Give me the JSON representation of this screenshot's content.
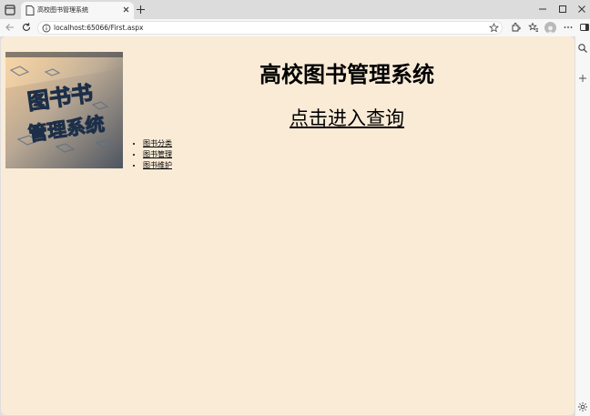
{
  "browser": {
    "tab_title": "高校图书管理系统",
    "url": "localhost:65066/First.aspx"
  },
  "page": {
    "title": "高校图书管理系统",
    "query_link": "点击进入查询",
    "nav_items": [
      "图书分类",
      "图书管理",
      "图书维护"
    ],
    "logo_text": [
      "图书书",
      "管理系统"
    ]
  },
  "colors": {
    "page_background": "#faebd7",
    "chrome_background": "#f7f7f7",
    "tabstrip_background": "#dcdcdc"
  }
}
